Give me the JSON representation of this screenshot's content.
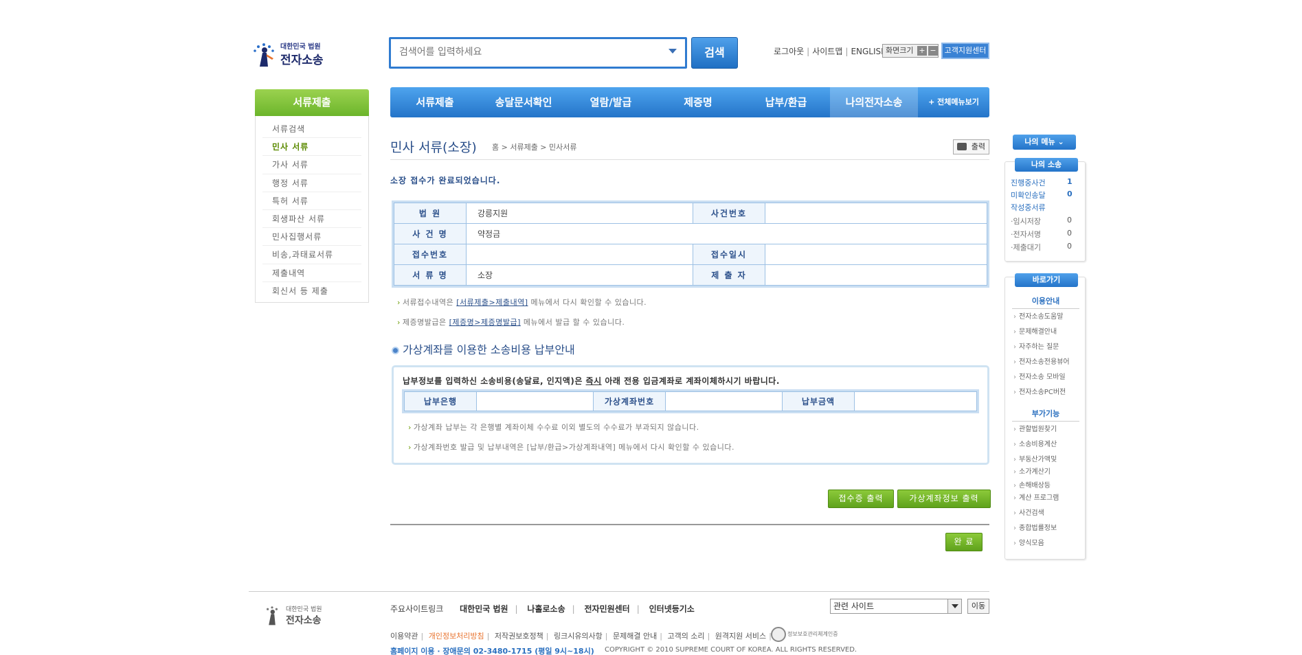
{
  "header": {
    "logo_top": "대한민국 법원",
    "logo_main": "전자소송",
    "search_placeholder": "검색어를 입력하세요",
    "search_button": "검색",
    "util_links": [
      "로그아웃",
      "사이트맵",
      "ENGLISH"
    ],
    "font_size_label": "화면크기",
    "font_plus": "+",
    "font_minus": "−",
    "help_center": "고객지원센터"
  },
  "sidebar": {
    "title": "서류제출",
    "items": [
      {
        "label": "서류검색"
      },
      {
        "label": "민사 서류",
        "active": true
      },
      {
        "label": "가사 서류"
      },
      {
        "label": "행정 서류"
      },
      {
        "label": "특허 서류"
      },
      {
        "label": "회생파산 서류"
      },
      {
        "label": "민사집행서류"
      },
      {
        "label": "비송,과태료서류"
      },
      {
        "label": "제출내역"
      },
      {
        "label": "회신서 등 제출"
      }
    ]
  },
  "topnav": {
    "tabs": [
      "서류제출",
      "송달문서확인",
      "열람/발급",
      "제증명",
      "납부/환급",
      "나의전자소송"
    ],
    "active_tab": "나의전자소송",
    "all_menu": "+ 전체메뉴보기"
  },
  "main": {
    "title": "민사 서류(소장)",
    "breadcrumb": "홈 > 서류제출 > 민사서류",
    "print": "출력",
    "done_message": "소장 접수가 완료되었습니다.",
    "info": {
      "court_label": "법  원",
      "court_value": "강릉지원",
      "case_no_label": "사건번호",
      "case_no_value": "",
      "case_name_label": "사 건 명",
      "case_name_value": "약정금",
      "receipt_no_label": "접수번호",
      "receipt_no_value": "",
      "receipt_date_label": "접수일시",
      "receipt_date_value": "",
      "doc_name_label": "서 류 명",
      "doc_name_value": "소장",
      "submitter_label": "제 출 자",
      "submitter_value": ""
    },
    "note1_pre": "서류접수내역은 ",
    "note1_link": "[서류제출>제출내역]",
    "note1_post": " 메뉴에서 다시 확인할 수 있습니다.",
    "note2_pre": "제증명발급은 ",
    "note2_link": "[제증명>제증명발급]",
    "note2_post": " 메뉴에서 발급 할 수 있습니다.",
    "section2_title": "가상계좌를 이용한 소송비용 납부안내",
    "va_desc_pre": "납부정보를 입력하신 소송비용(송달료, 인지액)은 ",
    "va_desc_u": "즉시",
    "va_desc_post": " 아래 전용 입금계좌로 계좌이체하시기 바랍니다.",
    "va_bank_label": "납부은행",
    "va_bank_value": "",
    "va_account_label": "가상계좌번호",
    "va_account_value": "",
    "va_amount_label": "납부금액",
    "va_amount_value": "",
    "va_note1": "가상계좌 납부는 각 은행별 계좌이체 수수료 이외 별도의 수수료가 부과되지 않습니다.",
    "va_note2": "가상계좌번호 발급 및 납부내역은 [납부/환급>가상계좌내역] 메뉴에서 다시 확인할 수 있습니다.",
    "btn_receipt": "접수증 출력",
    "btn_va_print": "가상계좌정보 출력",
    "btn_done": "완 료"
  },
  "right": {
    "my_menu": "나의 메뉴 ⌄",
    "my_suit_title": "나의 소송",
    "rows": [
      {
        "label": "진행중사건",
        "num": "1"
      },
      {
        "label": "미확인송달",
        "num": "0"
      },
      {
        "label": "작성중서류",
        "num": ""
      },
      {
        "label": "·임시저장",
        "num": "0"
      },
      {
        "label": "·전자서명",
        "num": "0"
      },
      {
        "label": "·제출대기",
        "num": "0"
      }
    ],
    "quick_title": "바로가기",
    "group1": "이용안내",
    "group1_links": [
      "전자소송도움말",
      "문제해결안내",
      "자주하는 질문",
      "전자소송전용뷰어",
      "전자소송 모바일",
      "전자소송PC버전"
    ],
    "group2": "부가기능",
    "group2_links": [
      "관할법원찾기",
      "소송비용계산",
      "부동산가액및",
      "소가계산기",
      "손해배상등",
      "계산 프로그램",
      "사건검색",
      "종합법률정보",
      "양식모음"
    ]
  },
  "footer": {
    "logo_top": "대한민국 법원",
    "logo_main": "전자소송",
    "main_sites_label": "주요사이트링크",
    "sites": [
      "대한민국 법원",
      "나홀로소송",
      "전자민원센터",
      "인터넷등기소"
    ],
    "related_select": "관련 사이트",
    "go": "이동",
    "links": [
      "이용약관",
      "개인정보처리방침",
      "저작권보호정책",
      "링크시유의사항",
      "문제해결 안내",
      "고객의 소리",
      "원격지원 서비스"
    ],
    "privacy_badge": "정보보호관리체계인증",
    "contact": "홈페이지 이용 · 장애문의 02-3480-1715 (평일 9시~18시)",
    "copyright": "COPYRIGHT © 2010 SUPREME COURT OF KOREA. ALL RIGHTS RESERVED."
  },
  "colors": {
    "brand_blue": "#2474c9",
    "accent_green": "#6cb52b",
    "title_blue": "#2a4f8a"
  }
}
